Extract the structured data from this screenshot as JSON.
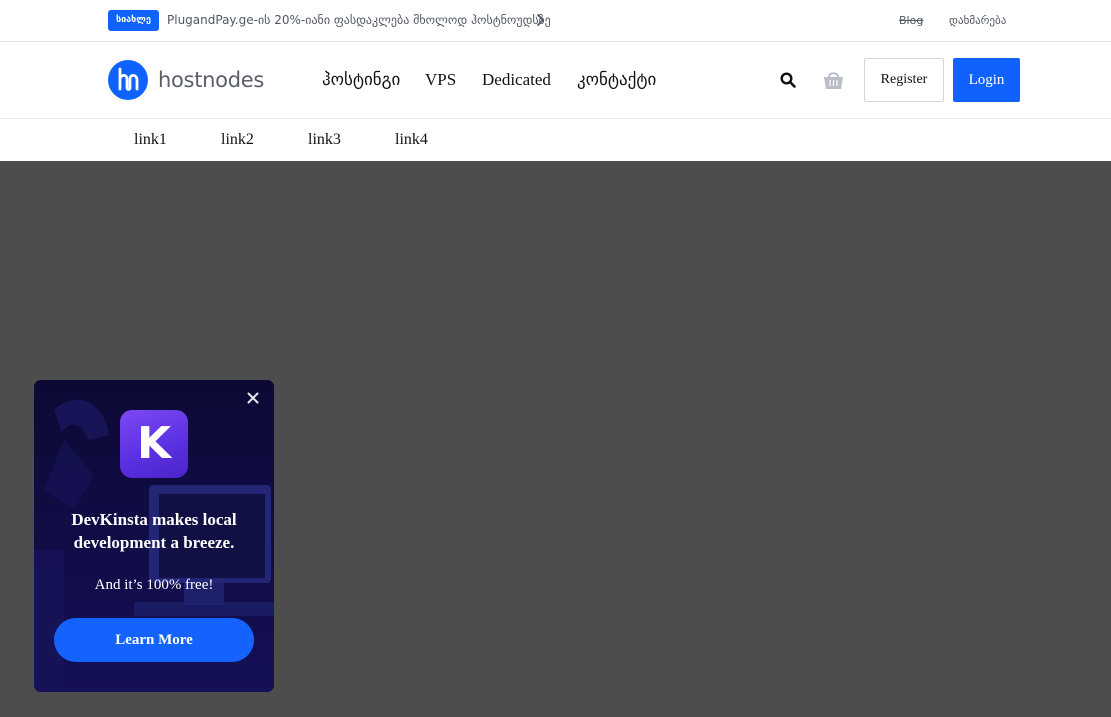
{
  "topbar": {
    "badge": "სიახლე",
    "promo": "PlugandPay.ge-ის 20%-იანი ფასდაკლება მხოლოდ ჰოსტნოუდსზე",
    "blog": "Blog",
    "help": "დახმარება"
  },
  "header": {
    "logo_text": "hostnodes",
    "nav": [
      "ჰოსტინგი",
      "VPS",
      "Dedicated",
      "კონტაქტი"
    ],
    "register_label": "Register",
    "login_label": "Login"
  },
  "subnav": {
    "links": [
      "link1",
      "link2",
      "link3",
      "link4"
    ]
  },
  "popup": {
    "logo_letter": "K",
    "title": "DevKinsta makes local development a breeze.",
    "subtitle": "And it’s 100% free!",
    "cta_label": "Learn More"
  },
  "colors": {
    "brand_blue": "#0f62fe",
    "overlay": "#4d4d4d",
    "popup_bg": "#0d0a3a",
    "kinsta_purple": "#6b3df0"
  },
  "icons": {
    "search": "search-icon",
    "cart": "cart-icon",
    "close": "close-icon",
    "chevron": "chevron-right-icon"
  }
}
